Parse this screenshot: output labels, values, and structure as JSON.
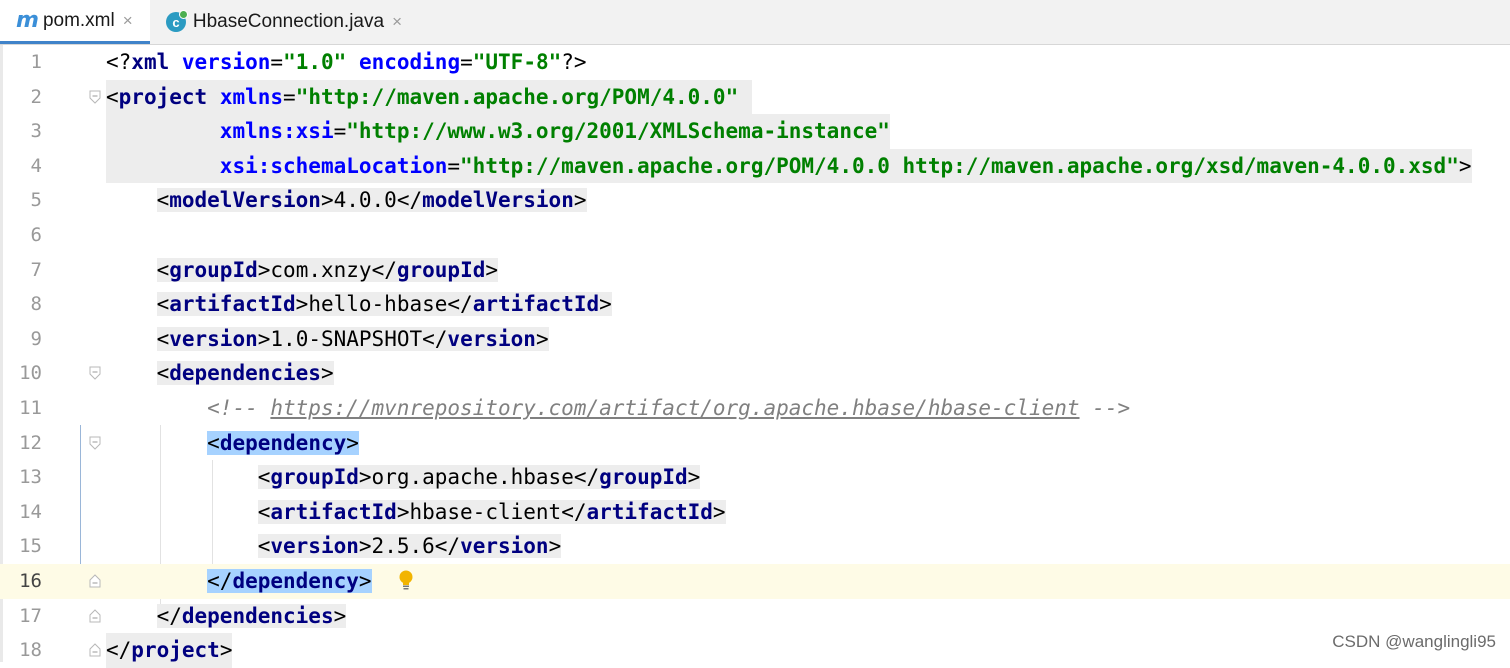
{
  "tabs": [
    {
      "label": "pom.xml",
      "icon": "maven-icon",
      "icon_glyph": "m",
      "active": true
    },
    {
      "label": "HbaseConnection.java",
      "icon": "java-class-icon",
      "icon_glyph": "c",
      "active": false
    }
  ],
  "close_glyph": "×",
  "lines": [
    {
      "n": "1"
    },
    {
      "n": "2"
    },
    {
      "n": "3"
    },
    {
      "n": "4"
    },
    {
      "n": "5"
    },
    {
      "n": "6"
    },
    {
      "n": "7"
    },
    {
      "n": "8"
    },
    {
      "n": "9"
    },
    {
      "n": "10"
    },
    {
      "n": "11"
    },
    {
      "n": "12"
    },
    {
      "n": "13"
    },
    {
      "n": "14"
    },
    {
      "n": "15"
    },
    {
      "n": "16"
    },
    {
      "n": "17"
    },
    {
      "n": "18"
    }
  ],
  "code": {
    "l1": {
      "open": "<?",
      "tag": "xml",
      "a1": "version",
      "eq": "=",
      "v1": "\"1.0\"",
      "a2": "encoding",
      "v2": "\"UTF-8\"",
      "close": "?>"
    },
    "l2": {
      "open": "<",
      "tag": "project",
      "a1": "xmlns",
      "eq": "=",
      "v1": "\"http://maven.apache.org/POM/4.0.0\""
    },
    "l3": {
      "a1": "xmlns:xsi",
      "eq": "=",
      "v1": "\"http://www.w3.org/2001/XMLSchema-instance\""
    },
    "l4": {
      "a1": "xsi:schemaLocation",
      "eq": "=",
      "v1": "\"http://maven.apache.org/POM/4.0.0 http://maven.apache.org/xsd/maven-4.0.0.xsd\"",
      "close": ">"
    },
    "l5": {
      "lt": "<",
      "gt": ">",
      "ltc": "</",
      "tag": "modelVersion",
      "val": "4.0.0"
    },
    "l7": {
      "lt": "<",
      "gt": ">",
      "ltc": "</",
      "tag": "groupId",
      "val": "com.xnzy"
    },
    "l8": {
      "lt": "<",
      "gt": ">",
      "ltc": "</",
      "tag": "artifactId",
      "val": "hello-hbase"
    },
    "l9": {
      "lt": "<",
      "gt": ">",
      "ltc": "</",
      "tag": "version",
      "val": "1.0-SNAPSHOT"
    },
    "l10": {
      "lt": "<",
      "gt": ">",
      "tag": "dependencies"
    },
    "l11": {
      "open": "<!-- ",
      "link": "https://mvnrepository.com/artifact/org.apache.hbase/hbase-client",
      "close": " -->"
    },
    "l12": {
      "lt": "<",
      "gt": ">",
      "tag": "dependency"
    },
    "l13": {
      "lt": "<",
      "gt": ">",
      "ltc": "</",
      "tag": "groupId",
      "val": "org.apache.hbase"
    },
    "l14": {
      "lt": "<",
      "gt": ">",
      "ltc": "</",
      "tag": "artifactId",
      "val": "hbase-client"
    },
    "l15": {
      "lt": "<",
      "gt": ">",
      "ltc": "</",
      "tag": "version",
      "val": "2.5.6"
    },
    "l16": {
      "ltc": "</",
      "gt": ">",
      "tag": "dependency"
    },
    "l17": {
      "ltc": "</",
      "gt": ">",
      "tag": "dependencies"
    },
    "l18": {
      "ltc": "</",
      "gt": ">",
      "tag": "project"
    }
  },
  "watermark": "CSDN @wanglingli95",
  "colors": {
    "tag": "#000080",
    "attr": "#0000ff",
    "string": "#008000",
    "comment": "#808080",
    "tab_accent": "#4083c9",
    "current_line": "#fefbe6",
    "tag_match": "#a6d2ff"
  }
}
